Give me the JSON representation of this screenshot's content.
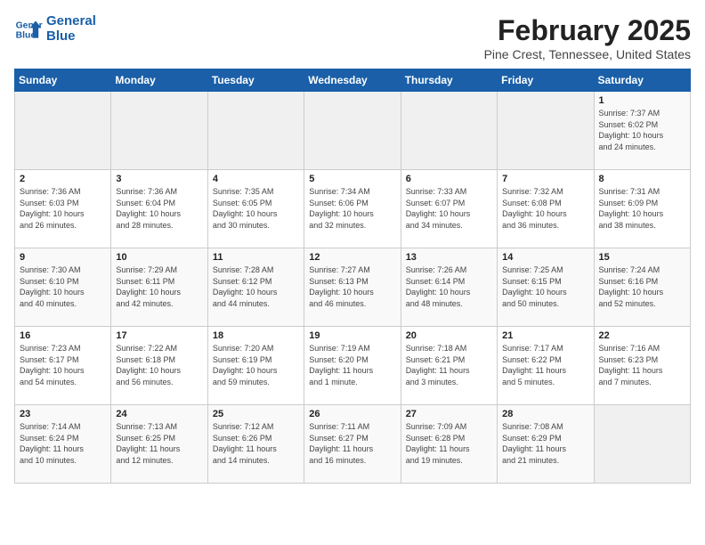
{
  "header": {
    "logo_line1": "General",
    "logo_line2": "Blue",
    "title": "February 2025",
    "subtitle": "Pine Crest, Tennessee, United States"
  },
  "weekdays": [
    "Sunday",
    "Monday",
    "Tuesday",
    "Wednesday",
    "Thursday",
    "Friday",
    "Saturday"
  ],
  "weeks": [
    [
      {
        "day": "",
        "info": ""
      },
      {
        "day": "",
        "info": ""
      },
      {
        "day": "",
        "info": ""
      },
      {
        "day": "",
        "info": ""
      },
      {
        "day": "",
        "info": ""
      },
      {
        "day": "",
        "info": ""
      },
      {
        "day": "1",
        "info": "Sunrise: 7:37 AM\nSunset: 6:02 PM\nDaylight: 10 hours\nand 24 minutes."
      }
    ],
    [
      {
        "day": "2",
        "info": "Sunrise: 7:36 AM\nSunset: 6:03 PM\nDaylight: 10 hours\nand 26 minutes."
      },
      {
        "day": "3",
        "info": "Sunrise: 7:36 AM\nSunset: 6:04 PM\nDaylight: 10 hours\nand 28 minutes."
      },
      {
        "day": "4",
        "info": "Sunrise: 7:35 AM\nSunset: 6:05 PM\nDaylight: 10 hours\nand 30 minutes."
      },
      {
        "day": "5",
        "info": "Sunrise: 7:34 AM\nSunset: 6:06 PM\nDaylight: 10 hours\nand 32 minutes."
      },
      {
        "day": "6",
        "info": "Sunrise: 7:33 AM\nSunset: 6:07 PM\nDaylight: 10 hours\nand 34 minutes."
      },
      {
        "day": "7",
        "info": "Sunrise: 7:32 AM\nSunset: 6:08 PM\nDaylight: 10 hours\nand 36 minutes."
      },
      {
        "day": "8",
        "info": "Sunrise: 7:31 AM\nSunset: 6:09 PM\nDaylight: 10 hours\nand 38 minutes."
      }
    ],
    [
      {
        "day": "9",
        "info": "Sunrise: 7:30 AM\nSunset: 6:10 PM\nDaylight: 10 hours\nand 40 minutes."
      },
      {
        "day": "10",
        "info": "Sunrise: 7:29 AM\nSunset: 6:11 PM\nDaylight: 10 hours\nand 42 minutes."
      },
      {
        "day": "11",
        "info": "Sunrise: 7:28 AM\nSunset: 6:12 PM\nDaylight: 10 hours\nand 44 minutes."
      },
      {
        "day": "12",
        "info": "Sunrise: 7:27 AM\nSunset: 6:13 PM\nDaylight: 10 hours\nand 46 minutes."
      },
      {
        "day": "13",
        "info": "Sunrise: 7:26 AM\nSunset: 6:14 PM\nDaylight: 10 hours\nand 48 minutes."
      },
      {
        "day": "14",
        "info": "Sunrise: 7:25 AM\nSunset: 6:15 PM\nDaylight: 10 hours\nand 50 minutes."
      },
      {
        "day": "15",
        "info": "Sunrise: 7:24 AM\nSunset: 6:16 PM\nDaylight: 10 hours\nand 52 minutes."
      }
    ],
    [
      {
        "day": "16",
        "info": "Sunrise: 7:23 AM\nSunset: 6:17 PM\nDaylight: 10 hours\nand 54 minutes."
      },
      {
        "day": "17",
        "info": "Sunrise: 7:22 AM\nSunset: 6:18 PM\nDaylight: 10 hours\nand 56 minutes."
      },
      {
        "day": "18",
        "info": "Sunrise: 7:20 AM\nSunset: 6:19 PM\nDaylight: 10 hours\nand 59 minutes."
      },
      {
        "day": "19",
        "info": "Sunrise: 7:19 AM\nSunset: 6:20 PM\nDaylight: 11 hours\nand 1 minute."
      },
      {
        "day": "20",
        "info": "Sunrise: 7:18 AM\nSunset: 6:21 PM\nDaylight: 11 hours\nand 3 minutes."
      },
      {
        "day": "21",
        "info": "Sunrise: 7:17 AM\nSunset: 6:22 PM\nDaylight: 11 hours\nand 5 minutes."
      },
      {
        "day": "22",
        "info": "Sunrise: 7:16 AM\nSunset: 6:23 PM\nDaylight: 11 hours\nand 7 minutes."
      }
    ],
    [
      {
        "day": "23",
        "info": "Sunrise: 7:14 AM\nSunset: 6:24 PM\nDaylight: 11 hours\nand 10 minutes."
      },
      {
        "day": "24",
        "info": "Sunrise: 7:13 AM\nSunset: 6:25 PM\nDaylight: 11 hours\nand 12 minutes."
      },
      {
        "day": "25",
        "info": "Sunrise: 7:12 AM\nSunset: 6:26 PM\nDaylight: 11 hours\nand 14 minutes."
      },
      {
        "day": "26",
        "info": "Sunrise: 7:11 AM\nSunset: 6:27 PM\nDaylight: 11 hours\nand 16 minutes."
      },
      {
        "day": "27",
        "info": "Sunrise: 7:09 AM\nSunset: 6:28 PM\nDaylight: 11 hours\nand 19 minutes."
      },
      {
        "day": "28",
        "info": "Sunrise: 7:08 AM\nSunset: 6:29 PM\nDaylight: 11 hours\nand 21 minutes."
      },
      {
        "day": "",
        "info": ""
      }
    ]
  ]
}
